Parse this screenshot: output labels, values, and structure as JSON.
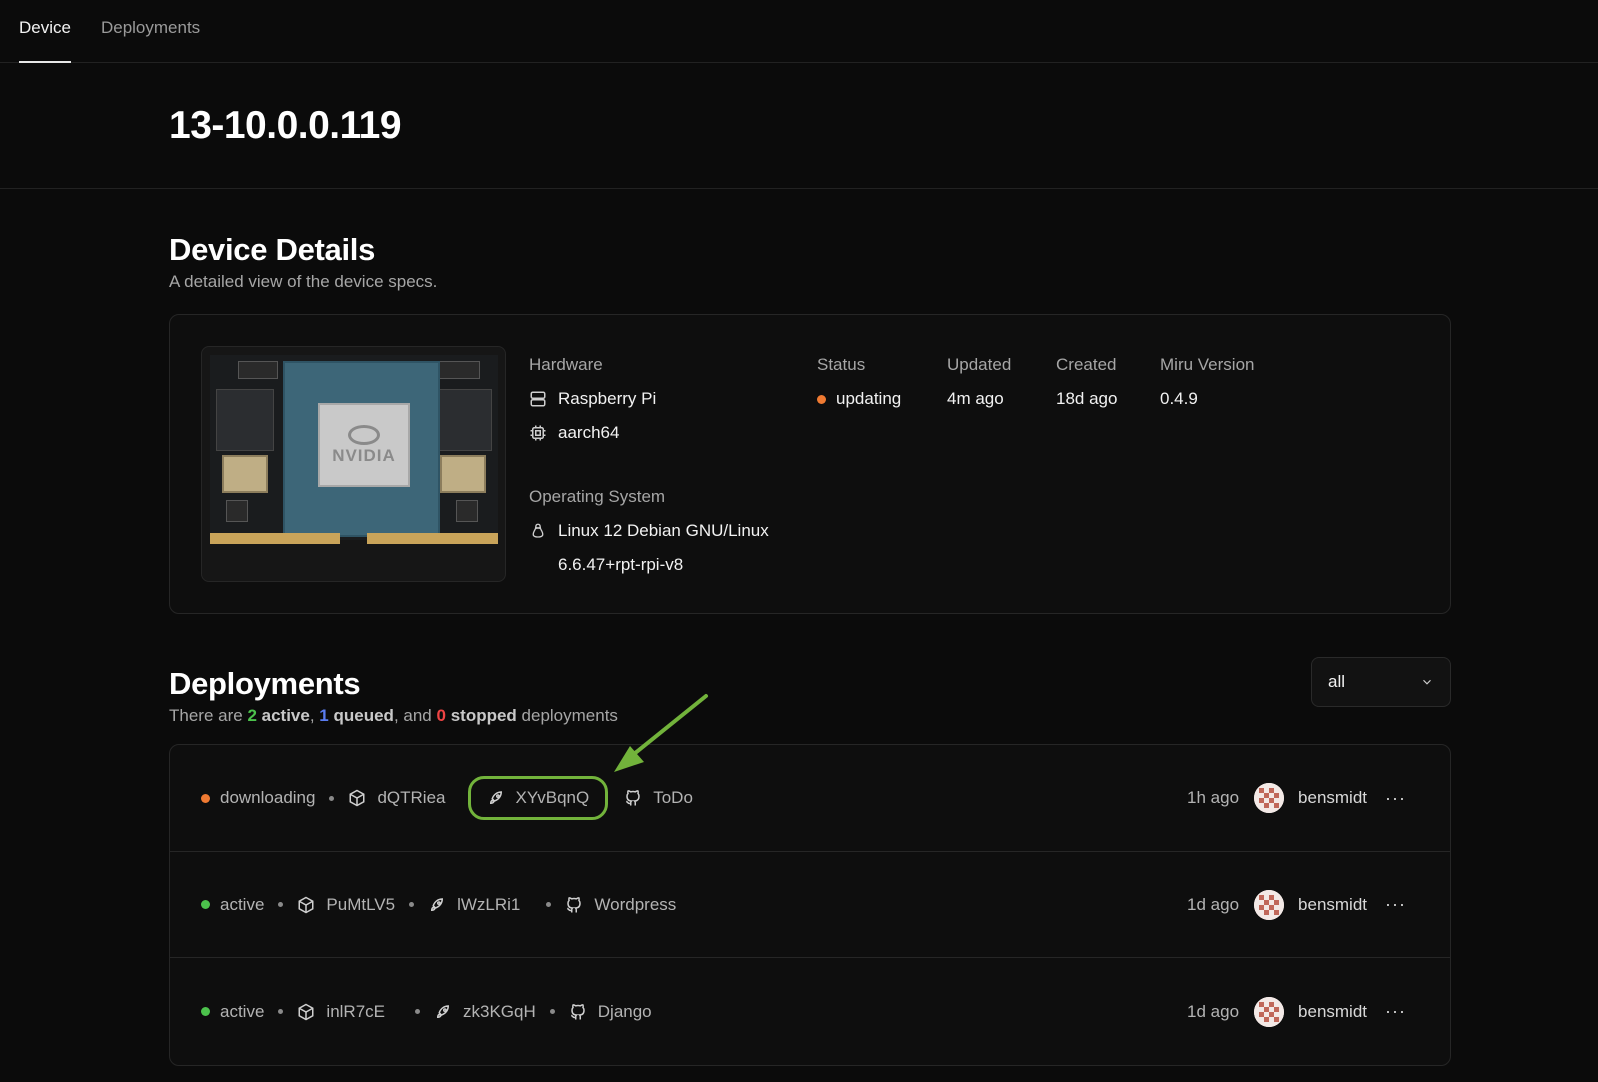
{
  "nav": {
    "tabs": [
      {
        "label": "Device"
      },
      {
        "label": "Deployments"
      }
    ]
  },
  "page_title": "13-10.0.0.119",
  "details": {
    "title": "Device Details",
    "subtitle": "A detailed view of the device specs.",
    "image_brand": "NVIDIA",
    "hardware_label": "Hardware",
    "hardware_name": "Raspberry Pi",
    "architecture": "aarch64",
    "os_label": "Operating System",
    "os_name": "Linux 12 Debian GNU/Linux",
    "os_kernel": "6.6.47+rpt-rpi-v8",
    "status_label": "Status",
    "status_value": "updating",
    "updated_label": "Updated",
    "updated_value": "4m ago",
    "created_label": "Created",
    "created_value": "18d ago",
    "version_label": "Miru Version",
    "version_value": "0.4.9"
  },
  "deployments": {
    "title": "Deployments",
    "summary": {
      "prefix": "There are ",
      "active_count": "2",
      "active_word": "active",
      "comma": ", ",
      "queued_count": "1",
      "queued_word": "queued",
      "and": ", and ",
      "stopped_count": "0",
      "stopped_word": "stopped",
      "suffix": " deployments"
    },
    "filter_value": "all",
    "rows": [
      {
        "status": "downloading",
        "package": "dQTRiea",
        "release": "XYvBqnQ",
        "repo": "ToDo",
        "ago": "1h ago",
        "user": "bensmidt",
        "more": "···"
      },
      {
        "status": "active",
        "package": "PuMtLV5",
        "release": "lWzLRi1",
        "repo": "Wordpress",
        "ago": "1d ago",
        "user": "bensmidt",
        "more": "···"
      },
      {
        "status": "active",
        "package": "inlR7cE",
        "release": "zk3KGqH",
        "repo": "Django",
        "ago": "1d ago",
        "user": "bensmidt",
        "more": "···"
      }
    ]
  },
  "colors": {
    "orange": "#ef7a32",
    "green": "#4cc24c",
    "blue": "#5a7cf0",
    "red": "#ef4444",
    "highlight": "#72b33b"
  }
}
